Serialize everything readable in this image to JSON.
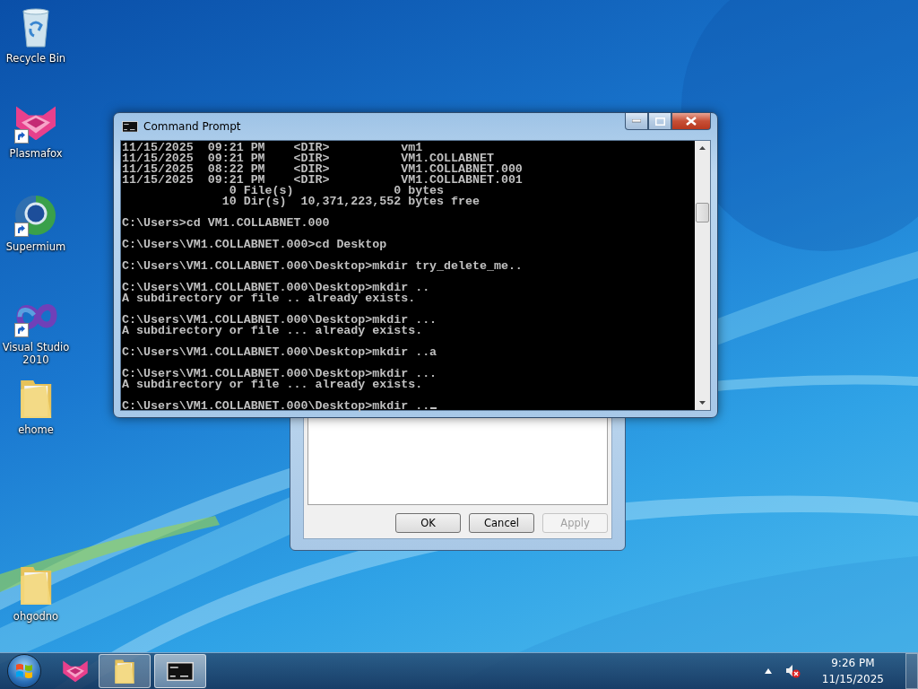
{
  "desktop_icons": [
    {
      "label": "Recycle Bin",
      "kind": "recycle",
      "shortcut": false
    },
    {
      "label": "Plasmafox",
      "kind": "fox",
      "shortcut": true
    },
    {
      "label": "Supermium",
      "kind": "globe",
      "shortcut": true
    },
    {
      "label": "Visual Studio 2010",
      "kind": "infinity",
      "shortcut": true
    },
    {
      "label": "ehome",
      "kind": "folder",
      "shortcut": false
    },
    {
      "label": "ohgodno",
      "kind": "folder",
      "shortcut": false
    }
  ],
  "dialog": {
    "buttons": [
      {
        "label": "OK",
        "disabled": false
      },
      {
        "label": "Cancel",
        "disabled": false
      },
      {
        "label": "Apply",
        "disabled": true
      }
    ]
  },
  "console": {
    "title": "Command Prompt",
    "active": true,
    "cursor": true,
    "blocks": [
      [
        "11/15/2025  09:21 PM    <DIR>          vm1",
        "11/15/2025  09:21 PM    <DIR>          VM1.COLLABNET",
        "11/15/2025  08:22 PM    <DIR>          VM1.COLLABNET.000",
        "11/15/2025  09:21 PM    <DIR>          VM1.COLLABNET.001",
        "               0 File(s)              0 bytes",
        "              10 Dir(s)  10,371,223,552 bytes free"
      ],
      [
        "C:\\Users>cd VM1.COLLABNET.000"
      ],
      [
        "C:\\Users\\VM1.COLLABNET.000>cd Desktop"
      ],
      [
        "C:\\Users\\VM1.COLLABNET.000\\Desktop>mkdir try_delete_me.."
      ],
      [
        "C:\\Users\\VM1.COLLABNET.000\\Desktop>mkdir ..",
        "A subdirectory or file .. already exists."
      ],
      [
        "C:\\Users\\VM1.COLLABNET.000\\Desktop>mkdir ...",
        "A subdirectory or file ... already exists."
      ],
      [
        "C:\\Users\\VM1.COLLABNET.000\\Desktop>mkdir ..a"
      ],
      [
        "C:\\Users\\VM1.COLLABNET.000\\Desktop>mkdir ...",
        "A subdirectory or file ... already exists."
      ],
      [
        "C:\\Users\\VM1.COLLABNET.000\\Desktop>mkdir .."
      ]
    ]
  },
  "taskbar": {
    "items": [
      {
        "kind": "fox",
        "open": false,
        "active": false
      },
      {
        "kind": "folder",
        "open": true,
        "active": false
      },
      {
        "kind": "console",
        "open": true,
        "active": true
      }
    ]
  },
  "tray": {
    "volume_muted": true,
    "time": "9:26 PM",
    "date": "11/15/2025"
  }
}
